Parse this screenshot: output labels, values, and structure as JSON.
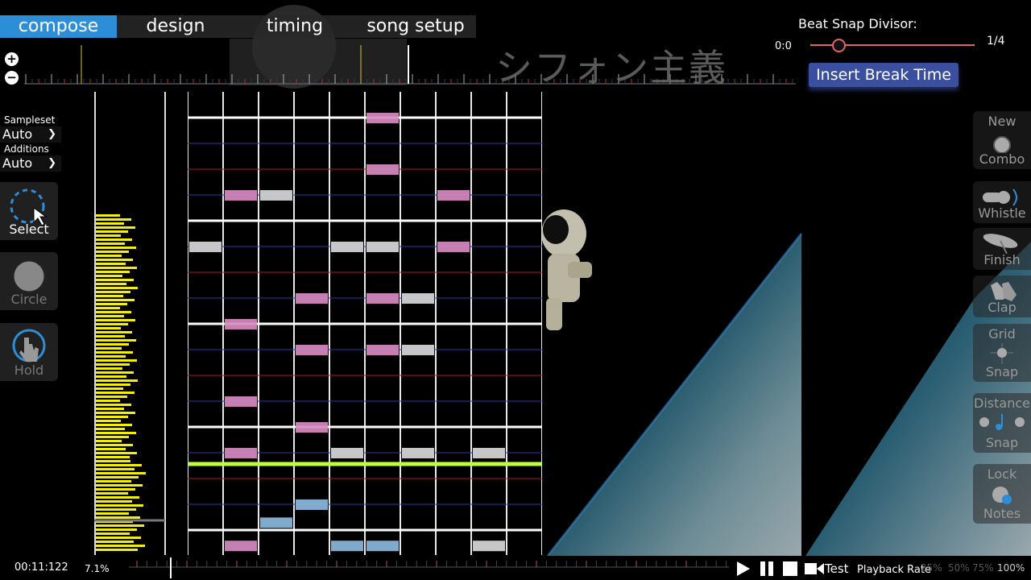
{
  "tabs": [
    {
      "label": "compose",
      "active": true
    },
    {
      "label": "design",
      "active": false
    },
    {
      "label": "timing",
      "active": false
    },
    {
      "label": "song setup",
      "active": false
    }
  ],
  "song_title_jp": "シフォン主義",
  "beat_snap": {
    "label": "Beat Snap Divisor:",
    "time": "0:0",
    "value": "1/4",
    "level": 0.17
  },
  "insert_break_label": "Insert Break Time",
  "left_panel": {
    "sampleset_label": "Sampleset",
    "sampleset_value": "Auto",
    "additions_label": "Additions",
    "additions_value": "Auto",
    "tools": [
      {
        "label": "Select",
        "icon": "select-cursor-icon",
        "active": true
      },
      {
        "label": "Circle",
        "icon": "circle-icon",
        "active": false
      },
      {
        "label": "Hold",
        "icon": "hold-hand-icon",
        "active": false
      }
    ]
  },
  "right_panel": {
    "new_combo": [
      "New",
      "Combo"
    ],
    "whistle": "Whistle",
    "finish": "Finish",
    "clap": "Clap",
    "grid_snap": [
      "Grid",
      "Snap"
    ],
    "distance_snap": [
      "Distance",
      "Snap"
    ],
    "lock_notes": [
      "Lock",
      "Notes"
    ]
  },
  "bottom_bar": {
    "time": "00:11:122",
    "percent": "7.1%",
    "test_label": "Test",
    "playback_rate_label": "Playback Rate",
    "rates": [
      "25%",
      "50%",
      "75%",
      "100%"
    ],
    "active_rate": "100%"
  },
  "colors": {
    "accent": "#2d8ed8",
    "note_pink": "#d68ac0",
    "note_white": "#d8d8d8",
    "note_blue": "#8ab8dc",
    "measure_line": "#c0ff40",
    "beat_red": "#b01818",
    "beat_blue": "#2838a8",
    "break_button": "#3a4fa0"
  },
  "notes": [
    {
      "col": 6,
      "row": 0.5,
      "type": "pink"
    },
    {
      "col": 6,
      "row": 2.5,
      "type": "pink"
    },
    {
      "col": 2,
      "row": 3.5,
      "type": "pink"
    },
    {
      "col": 3,
      "row": 3.5,
      "type": "white"
    },
    {
      "col": 8,
      "row": 3.5,
      "type": "pink"
    },
    {
      "col": 1,
      "row": 5.5,
      "type": "white"
    },
    {
      "col": 5,
      "row": 5.5,
      "type": "white"
    },
    {
      "col": 6,
      "row": 5.5,
      "type": "white"
    },
    {
      "col": 8,
      "row": 5.5,
      "type": "pink"
    },
    {
      "col": 4,
      "row": 7.5,
      "type": "pink"
    },
    {
      "col": 6,
      "row": 7.5,
      "type": "pink"
    },
    {
      "col": 7,
      "row": 7.5,
      "type": "white"
    },
    {
      "col": 2,
      "row": 8.5,
      "type": "pink"
    },
    {
      "col": 4,
      "row": 9.5,
      "type": "pink"
    },
    {
      "col": 6,
      "row": 9.5,
      "type": "pink"
    },
    {
      "col": 7,
      "row": 9.5,
      "type": "white"
    },
    {
      "col": 2,
      "row": 11.5,
      "type": "pink"
    },
    {
      "col": 4,
      "row": 12.5,
      "type": "pink"
    },
    {
      "col": 2,
      "row": 13.5,
      "type": "pink"
    },
    {
      "col": 5,
      "row": 13.5,
      "type": "white"
    },
    {
      "col": 7,
      "row": 13.5,
      "type": "white"
    },
    {
      "col": 9,
      "row": 13.5,
      "type": "white"
    },
    {
      "col": 4,
      "row": 15.5,
      "type": "blue"
    },
    {
      "col": 3,
      "row": 16.2,
      "type": "blue"
    },
    {
      "col": 2,
      "row": 17.1,
      "type": "pink"
    },
    {
      "col": 5,
      "row": 17.1,
      "type": "blue"
    },
    {
      "col": 6,
      "row": 17.1,
      "type": "blue"
    },
    {
      "col": 9,
      "row": 17.1,
      "type": "white"
    }
  ]
}
